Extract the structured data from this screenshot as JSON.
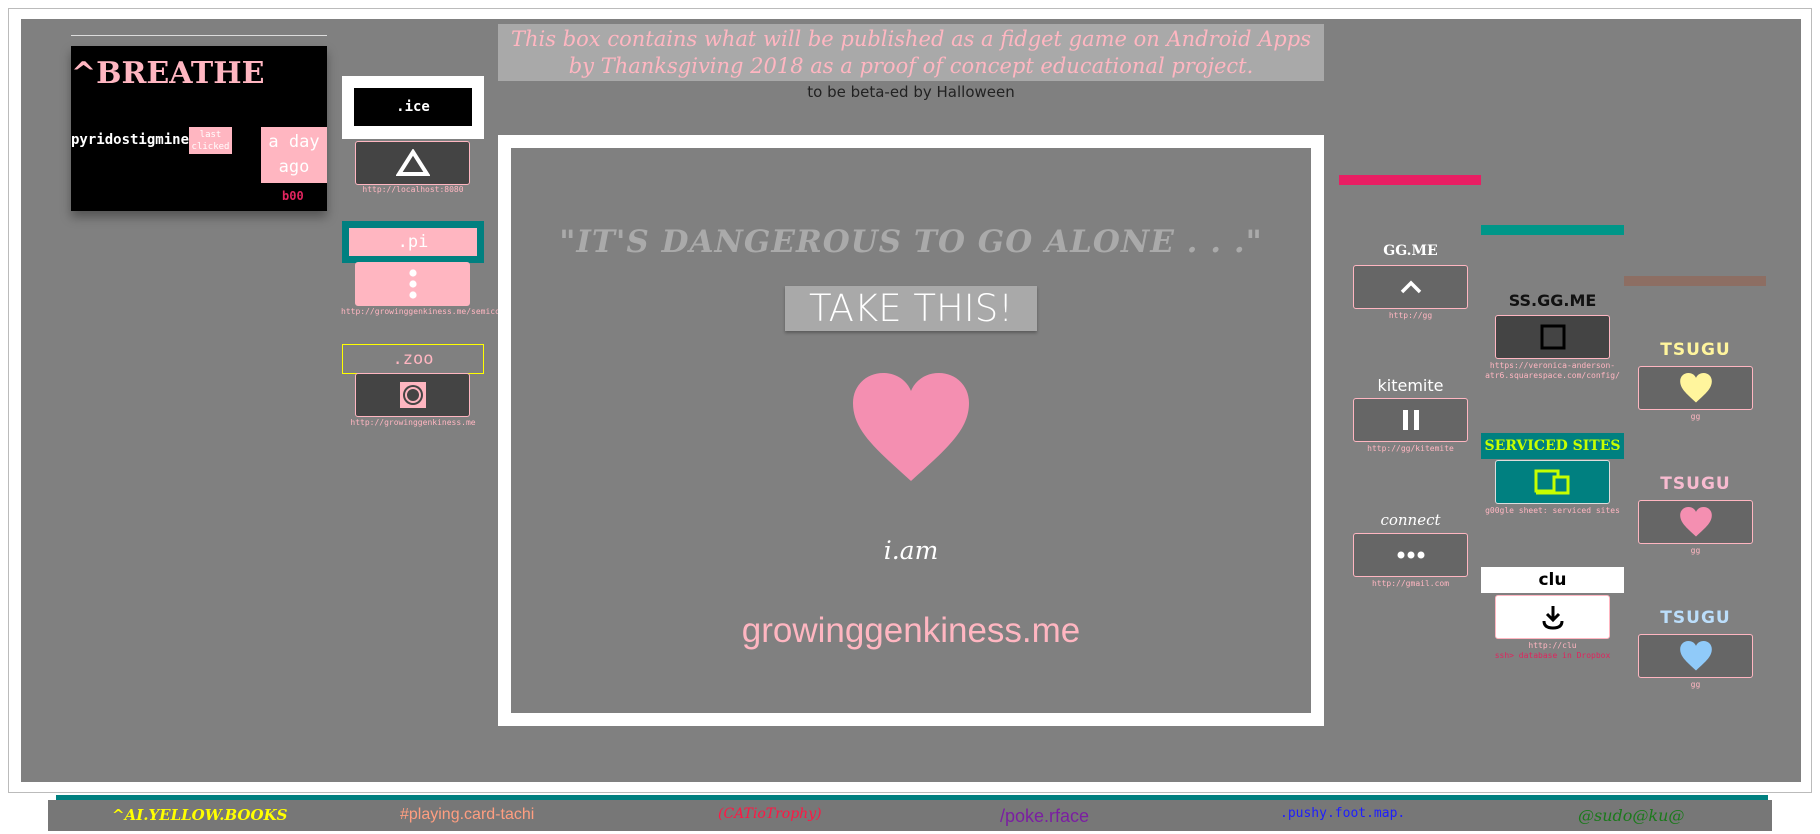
{
  "publish_notice": "This box contains what will be published as a fidget game on Android Apps by Thanksgiving 2018 as a proof of concept educational project.",
  "beta_notice": "to be beta-ed by Halloween",
  "breathe": {
    "title": "^BREATHE",
    "medication": "pyridostigmine",
    "last_clicked": "last clicked",
    "ago": "a day ago",
    "count": "b00"
  },
  "left_tiles": {
    "ice": {
      "label": ".ice",
      "url": "http://localhost:8080",
      "icon": "triangle-icon"
    },
    "pi": {
      "label": ".pi",
      "url": "http://growinggenkiness.me/semicolon",
      "icon": "vertical-dots-icon"
    },
    "zoo": {
      "label": ".zoo",
      "url": "http://growinggenkiness.me",
      "icon": "lens-icon"
    }
  },
  "stage": {
    "quote": "\"IT'S DANGEROUS TO GO ALONE . . .\"",
    "button": "TAKE THIS!",
    "iam": "i.am",
    "site": "growinggenkiness.me",
    "heart_color": "#f48fb1"
  },
  "right_col1": {
    "gg": {
      "label": "GG.ME",
      "url": "http://gg",
      "icon": "chevron-up-icon"
    },
    "kitemite": {
      "label": "kitemite",
      "url": "http://gg/kitemite",
      "icon": "pause-icon"
    },
    "connect": {
      "label": "connect",
      "url": "http://gmail.com",
      "icon": "ellipsis-icon"
    }
  },
  "right_col2": {
    "ss": {
      "label": "SS.GG.ME",
      "url": "https://veronica-anderson-atr6.squarespace.com/config/",
      "icon": "square-icon"
    },
    "serviced": {
      "label": "SERVICED SITES",
      "url": "g00gle sheet: serviced sites",
      "icon": "devices-icon"
    },
    "clu": {
      "label": "clu",
      "url": "http://clu",
      "note": "ssh> database in Dropbox",
      "icon": "download-icon"
    }
  },
  "right_col3": {
    "tsugu": [
      {
        "label": "TSUGU",
        "url": "gg",
        "color": "#fff59d"
      },
      {
        "label": "TSUGU",
        "url": "gg",
        "color": "#f48fb1"
      },
      {
        "label": "TSUGU",
        "url": "gg",
        "color": "#90caf9"
      }
    ]
  },
  "accent_colors": {
    "crimson": "#e91e63",
    "teal": "#009688",
    "brown": "#8d6e63",
    "pink": "#ffb6c1"
  },
  "bottom_nav": [
    {
      "label": "^AI.YELLOW.BOOKS",
      "color": "#ffff00"
    },
    {
      "label": "#playing.card-tachi",
      "color": "#ff9e80"
    },
    {
      "label": "(CATioTrophy)",
      "color": "#ff1744"
    },
    {
      "label": "/poke.rface",
      "color": "#7b1fa2"
    },
    {
      "label": ".pushy.foot.map.",
      "color": "#1e1eff"
    },
    {
      "label": "@sudo@ku@",
      "color": "#1b7a1b"
    }
  ]
}
